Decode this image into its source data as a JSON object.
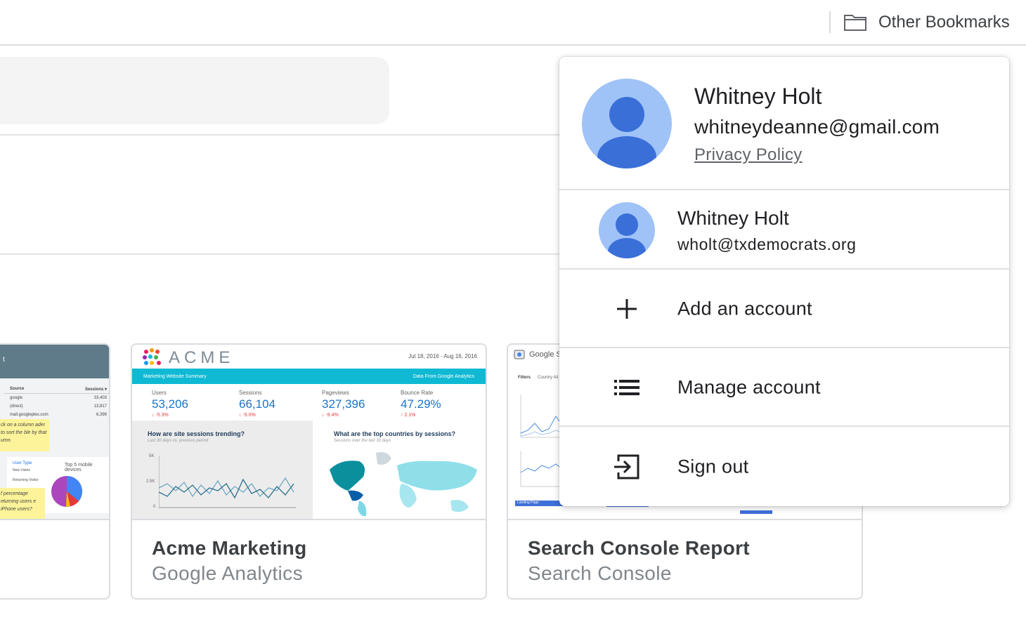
{
  "bookmarks_bar": {
    "folder_label": "Other Bookmarks",
    "folder_icon": "folder-icon"
  },
  "reports": [
    {
      "title": "Acme Marketing",
      "source": "Google Analytics",
      "thumbnail": {
        "logo_text": "ACME",
        "date_range": "Jul 18, 2016 - Aug 16, 2016",
        "band_left": "Marketing Website Summary",
        "band_right": "Data From Google Analytics",
        "stats": [
          {
            "label": "Users",
            "value": "53,206",
            "change": "↓ -5.3%"
          },
          {
            "label": "Sessions",
            "value": "66,104",
            "change": "↓ -5.0%"
          },
          {
            "label": "Pageviews",
            "value": "327,396",
            "change": "↓ -9.4%"
          },
          {
            "label": "Bounce Rate",
            "value": "47.29%",
            "change": "↑ 2.1%"
          }
        ],
        "trend_title": "How are site sessions trending?",
        "trend_sub": "Last 30 days vs. previous period",
        "map_title": "What are the top countries by sessions?",
        "map_sub": "Sessions over the last 30 days",
        "y_ticks": [
          "5K",
          "2.5K",
          "0"
        ]
      }
    },
    {
      "title": "Search Console Report",
      "source": "Search Console",
      "thumbnail": {
        "brand": "Google S",
        "filters_label": "Filters",
        "country_label": "Country All",
        "landing_label": "Landing Page"
      }
    }
  ],
  "left_card": {
    "head_text": "t",
    "table_header_source": "Source",
    "table_header_sessions": "Sessions ▾",
    "rows": [
      {
        "n": "1.",
        "source": "google",
        "sessions": "33,403"
      },
      {
        "n": "2.",
        "source": "(direct)",
        "sessions": "13,817"
      },
      {
        "n": "3.",
        "source": "mall.googleplex.com",
        "sessions": "6,399"
      }
    ],
    "sticky_top": "ck on a column ader to sort the ble by that umn.",
    "sticky_bottom": "f percentage eturning users e iPhone users?",
    "legend_title": "User Type",
    "legend_items": [
      "New Visitor",
      "Returning Visitor"
    ],
    "pie_title": "Top 5 mobile devices"
  },
  "account_menu": {
    "primary": {
      "name": "Whitney Holt",
      "email": "whitneydeanne@gmail.com",
      "privacy_label": "Privacy Policy"
    },
    "secondary": {
      "name": "Whitney Holt",
      "email": "wholt@txdemocrats.org"
    },
    "items": [
      {
        "label": "Add an account",
        "icon": "plus-icon"
      },
      {
        "label": "Manage account",
        "icon": "list-icon"
      },
      {
        "label": "Sign out",
        "icon": "sign-out-icon"
      }
    ]
  },
  "colors": {
    "avatar_bg": "#9fc2f7",
    "avatar_fg": "#3a6fd8",
    "acme_band": "#0fb9d3",
    "gsc_bar": "#3f6fd8"
  }
}
